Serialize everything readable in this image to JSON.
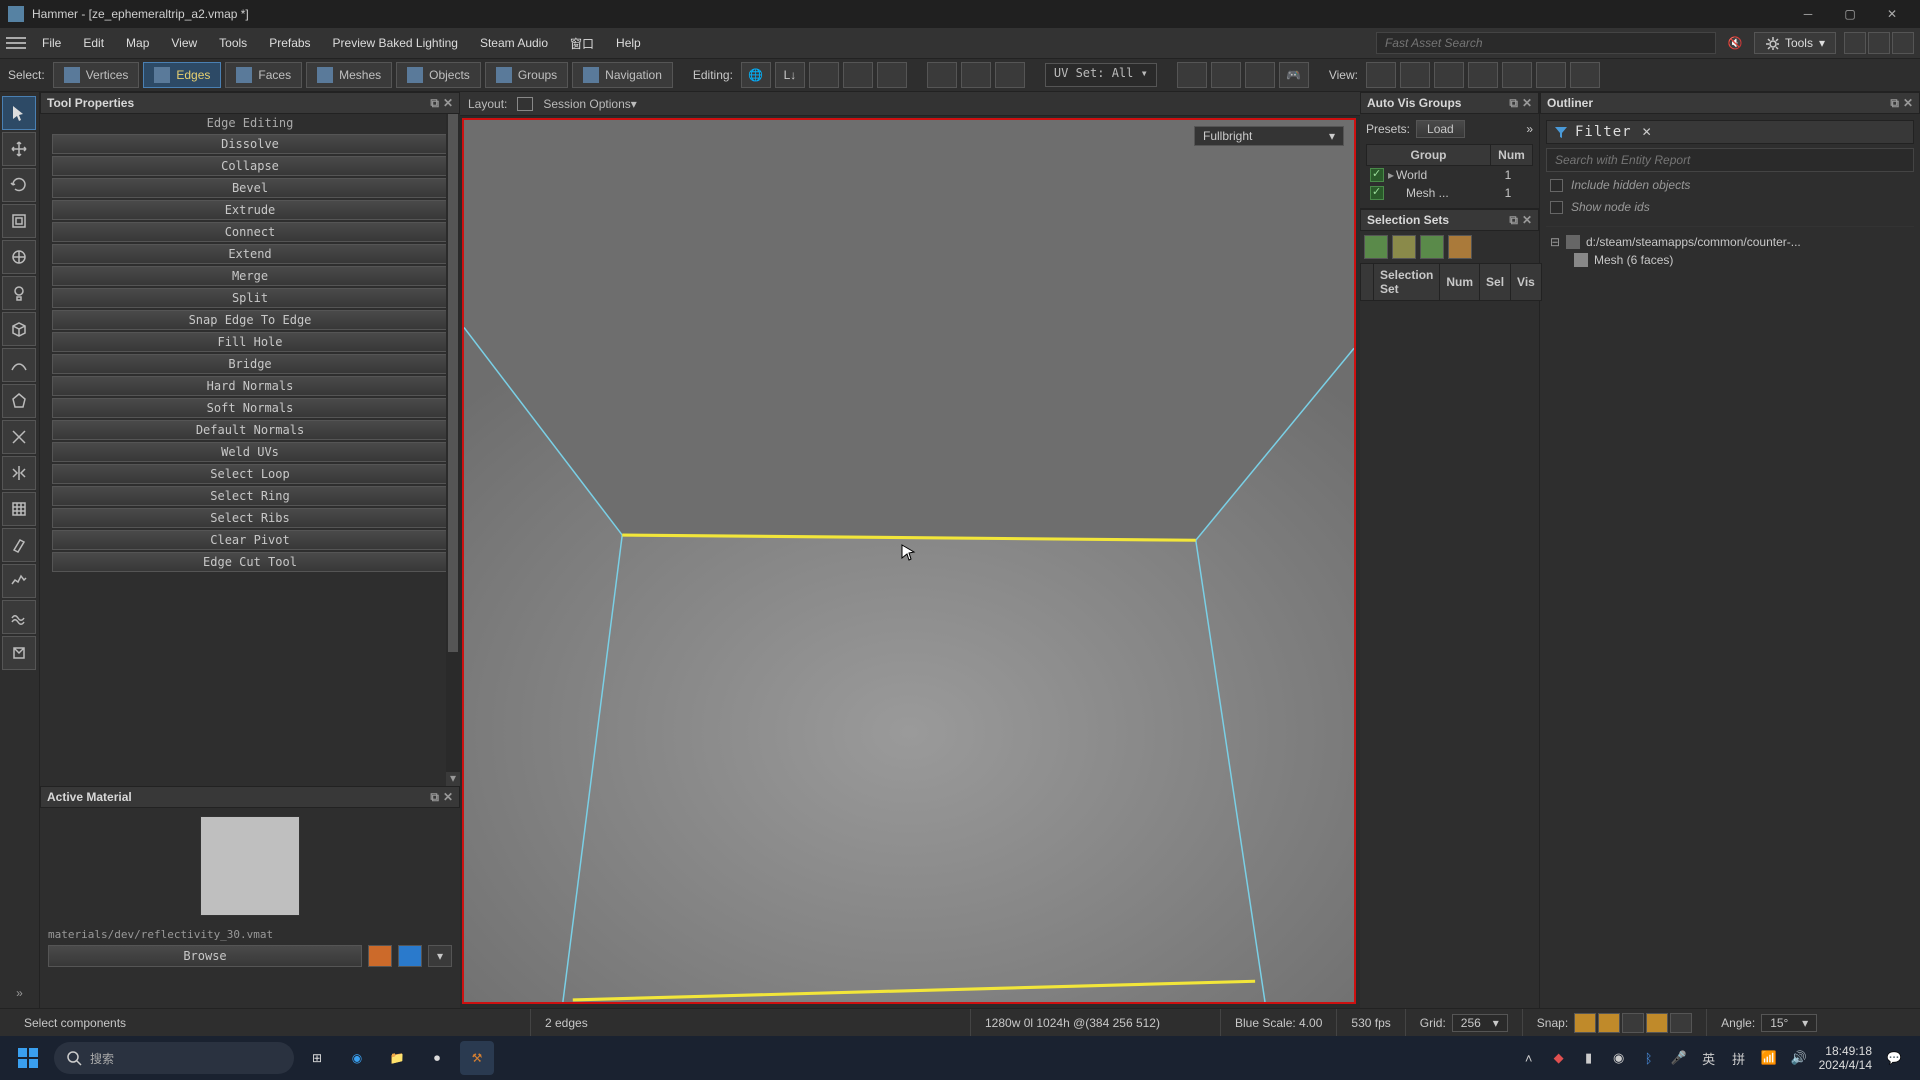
{
  "window": {
    "title": "Hammer - [ze_ephemeraltrip_a2.vmap *]"
  },
  "menu": {
    "items": [
      "File",
      "Edit",
      "Map",
      "View",
      "Tools",
      "Prefabs",
      "Preview Baked Lighting",
      "Steam Audio",
      "窗口",
      "Help"
    ],
    "fast_search_placeholder": "Fast Asset Search",
    "tools_label": "Tools"
  },
  "modestrip": {
    "select_label": "Select:",
    "modes": [
      {
        "label": "Vertices",
        "active": false
      },
      {
        "label": "Edges",
        "active": true
      },
      {
        "label": "Faces",
        "active": false
      },
      {
        "label": "Meshes",
        "active": false
      },
      {
        "label": "Objects",
        "active": false
      },
      {
        "label": "Groups",
        "active": false
      },
      {
        "label": "Navigation",
        "active": false
      }
    ],
    "editing_label": "Editing:",
    "uvset": "UV Set: All ▾",
    "view_label": "View:"
  },
  "tool_properties": {
    "title": "Tool Properties",
    "section": "Edge Editing",
    "buttons": [
      "Dissolve",
      "Collapse",
      "Bevel",
      "Extrude",
      "Connect",
      "Extend",
      "Merge",
      "Split",
      "Snap Edge To Edge",
      "Fill Hole",
      "Bridge",
      "Hard Normals",
      "Soft Normals",
      "Default Normals",
      "Weld UVs",
      "Select Loop",
      "Select Ring",
      "Select Ribs",
      "Clear Pivot",
      "Edge Cut Tool"
    ]
  },
  "active_material": {
    "title": "Active Material",
    "path": "materials/dev/reflectivity_30.vmat",
    "browse": "Browse"
  },
  "viewport": {
    "layout_label": "Layout:",
    "session_options": "Session Options▾",
    "shading": "Fullbright"
  },
  "auto_vis": {
    "title": "Auto Vis Groups",
    "presets_label": "Presets:",
    "load": "Load",
    "headers": {
      "group": "Group",
      "num": "Num"
    },
    "rows": [
      {
        "name": "World",
        "num": "1",
        "nested": false
      },
      {
        "name": "Mesh ...",
        "num": "1",
        "nested": true
      }
    ]
  },
  "outliner": {
    "title": "Outliner",
    "filter_label": "Filter",
    "search_placeholder": "Search with Entity Report",
    "include_hidden": "Include hidden objects",
    "show_node_ids": "Show node ids",
    "tree": [
      {
        "label": "d:/steam/steamapps/common/counter-...",
        "child": false
      },
      {
        "label": "Mesh (6 faces)",
        "child": true
      }
    ]
  },
  "selection_sets": {
    "title": "Selection Sets",
    "headers": {
      "set": "Selection Set",
      "num": "Num",
      "sel": "Sel",
      "vis": "Vis"
    }
  },
  "status": {
    "hint": "Select components",
    "edges": "2 edges",
    "coords": "1280w 0l 1024h @(384 256 512)",
    "blue_scale": "Blue Scale: 4.00",
    "fps": "530 fps",
    "grid_label": "Grid:",
    "grid_value": "256",
    "snap_label": "Snap:",
    "angle_label": "Angle:",
    "angle_value": "15°"
  },
  "taskbar": {
    "search": "搜索",
    "ime": [
      "英",
      "拼"
    ],
    "time": "18:49:18",
    "date": "2024/4/14"
  }
}
